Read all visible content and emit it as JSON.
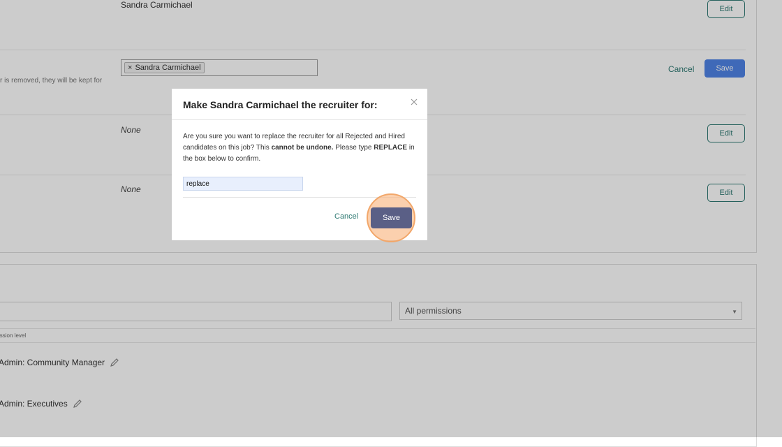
{
  "background": {
    "row1": {
      "value": "Sandra Carmichael",
      "edit_label": "Edit"
    },
    "row2": {
      "description_fragment": "r is removed, they will be kept for",
      "tag_label": "Sandra Carmichael",
      "tag_remove": "×",
      "cancel_label": "Cancel",
      "save_label": "Save"
    },
    "row3": {
      "value": "None",
      "edit_label": "Edit"
    },
    "row4": {
      "value": "None",
      "edit_label": "Edit"
    },
    "permissions": {
      "filter_value": "All permissions",
      "column_header": "ission level",
      "items": [
        {
          "label": "Admin: Community Manager"
        },
        {
          "label": "Admin: Executives"
        }
      ]
    }
  },
  "modal": {
    "title": "Make Sandra Carmichael the recruiter for:",
    "body_part1": "Are you sure you want to replace the recruiter for all Rejected and Hired candidates on this job? This ",
    "body_bold1": "cannot be undone.",
    "body_part2": " Please type ",
    "body_bold2": "REPLACE",
    "body_part3": " in the box below to confirm.",
    "input_value": "replace",
    "cancel_label": "Cancel",
    "save_label": "Save"
  },
  "colors": {
    "accent_teal": "#2f7a73",
    "save_blue": "#4f84e6",
    "modal_save": "#5a5f86",
    "highlight": "#f9b078"
  },
  "icons": [
    "close-icon",
    "pencil-icon",
    "remove-tag-icon",
    "caret-down-icon"
  ]
}
